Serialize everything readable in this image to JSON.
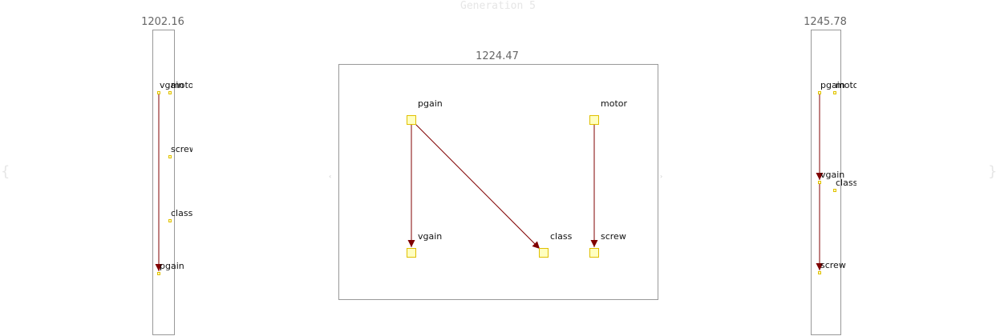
{
  "title": "Generation 5",
  "nav": {
    "left": "{",
    "right": "}",
    "mid_left": "‹",
    "mid_right": "›"
  },
  "colors": {
    "edge": "#800000",
    "node_fill": "#ffffc0",
    "node_border": "#e0c000",
    "frame": "#999999"
  },
  "panels": [
    {
      "id": "left",
      "score": "1202.16",
      "nodes": [
        {
          "id": "vgain",
          "label": "vgain"
        },
        {
          "id": "motor",
          "label": "motor"
        },
        {
          "id": "screw",
          "label": "screw"
        },
        {
          "id": "class",
          "label": "class"
        },
        {
          "id": "pgain",
          "label": "pgain"
        }
      ],
      "edges": [
        {
          "from": "vgain",
          "to": "pgain"
        }
      ]
    },
    {
      "id": "center",
      "score": "1224.47",
      "nodes": [
        {
          "id": "pgain",
          "label": "pgain"
        },
        {
          "id": "motor",
          "label": "motor"
        },
        {
          "id": "vgain",
          "label": "vgain"
        },
        {
          "id": "class",
          "label": "class"
        },
        {
          "id": "screw",
          "label": "screw"
        }
      ],
      "edges": [
        {
          "from": "pgain",
          "to": "vgain"
        },
        {
          "from": "pgain",
          "to": "class"
        },
        {
          "from": "motor",
          "to": "screw"
        }
      ]
    },
    {
      "id": "right",
      "score": "1245.78",
      "nodes": [
        {
          "id": "pgain",
          "label": "pgain"
        },
        {
          "id": "motor",
          "label": "motor"
        },
        {
          "id": "vgain",
          "label": "vgain"
        },
        {
          "id": "class",
          "label": "class"
        },
        {
          "id": "screw",
          "label": "screw"
        }
      ],
      "edges": [
        {
          "from": "pgain",
          "to": "vgain"
        },
        {
          "from": "vgain",
          "to": "screw"
        }
      ]
    }
  ]
}
